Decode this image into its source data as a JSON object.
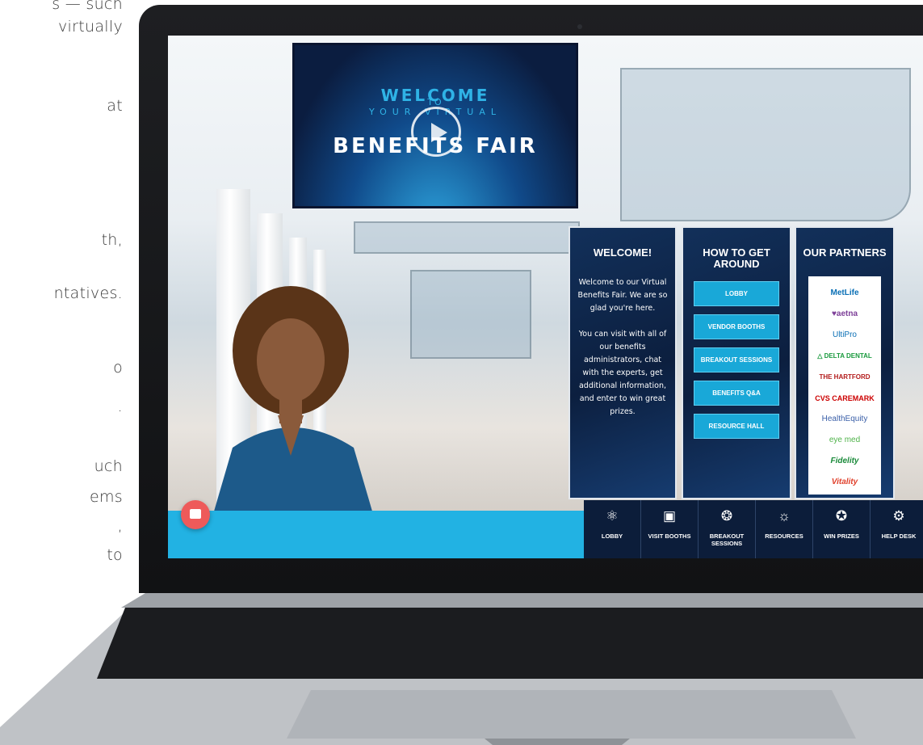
{
  "side_copy": {
    "lines": [
      "s — such",
      "virtually",
      "at",
      "th,",
      "ntatives.",
      "o",
      ".",
      "uch",
      "ems",
      ",",
      "to"
    ]
  },
  "video": {
    "welcome": "WELCOME",
    "to_your_virtual": "YOUR VIRTUAL",
    "to": "TO",
    "benefits_fair": "BENEFITS FAIR",
    "play_icon": "play-icon"
  },
  "panels": {
    "welcome": {
      "title": "WELCOME!",
      "p1": "Welcome to our Virtual Benefits Fair. We are so glad you're here.",
      "p2": "You can visit with all of our benefits administrators, chat with the experts, get additional information, and enter to win great prizes."
    },
    "navigation": {
      "title": "HOW TO GET AROUND",
      "buttons": [
        "LOBBY",
        "VENDOR BOOTHS",
        "BREAKOUT SESSIONS",
        "BENEFITS Q&A",
        "RESOURCE HALL"
      ]
    },
    "partners": {
      "title": "OUR PARTNERS",
      "logos": [
        "MetLife",
        "♥aetna",
        "UltiPro",
        "△ DELTA DENTAL",
        "THE HARTFORD",
        "CVS CAREMARK",
        "HealthEquity",
        "eye med",
        "Fidelity",
        "Vitality"
      ]
    }
  },
  "bottom_nav": [
    {
      "label": "LOBBY",
      "icon": "network-icon"
    },
    {
      "label": "VISIT BOOTHS",
      "icon": "booth-icon"
    },
    {
      "label": "BREAKOUT SESSIONS",
      "icon": "brain-icon"
    },
    {
      "label": "RESOURCES",
      "icon": "lightbulb-icon"
    },
    {
      "label": "WIN PRIZES",
      "icon": "award-icon"
    },
    {
      "label": "HELP DESK",
      "icon": "gear-search-icon"
    }
  ],
  "chat_icon": "chat-bubble-icon",
  "colors": {
    "accent": "#22b2e3",
    "navy": "#0c1d3a",
    "chat": "#ee5a5a"
  }
}
